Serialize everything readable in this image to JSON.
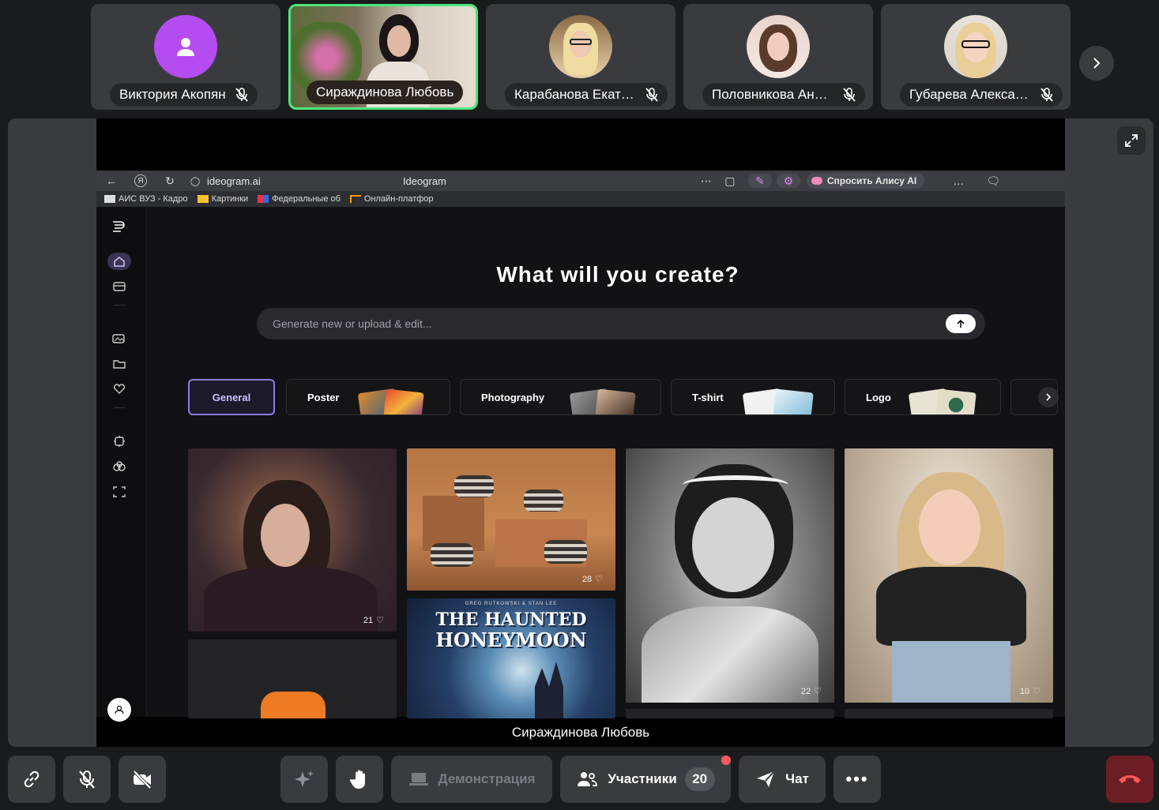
{
  "participants": [
    {
      "name": "Виктория Акопян"
    },
    {
      "name": "Сираждинова Любовь"
    },
    {
      "name": "Карабанова Екате..."
    },
    {
      "name": "Половникова Анас..."
    },
    {
      "name": "Губарева Алексан..."
    }
  ],
  "speaker": {
    "name": "Сираждинова Любовь"
  },
  "browser": {
    "url": "ideogram.ai",
    "tab_title": "Ideogram",
    "alice_label": "Спросить Алису AI",
    "bookmarks": [
      {
        "label": "АИС ВУЗ - Кадро"
      },
      {
        "label": "Картинки"
      },
      {
        "label": "Федеральные об"
      },
      {
        "label": "Онлайн-платфор"
      }
    ]
  },
  "ideogram": {
    "headline": "What will you create?",
    "prompt_placeholder": "Generate new or upload & edit...",
    "categories": [
      {
        "label": "General"
      },
      {
        "label": "Poster"
      },
      {
        "label": "Photography"
      },
      {
        "label": "T-shirt"
      },
      {
        "label": "Logo"
      }
    ],
    "poster_title_1": "THE HAUNTED",
    "poster_title_2": "HONEYMOON",
    "poster_credits": "GREG RUTKOWSKI & STAN LEE",
    "likes": [
      "21",
      "28",
      "22",
      "10"
    ]
  },
  "toolbar": {
    "demo_label": "Демонстрация",
    "participants_label": "Участники",
    "participants_count": "20",
    "chat_label": "Чат"
  },
  "colors": {
    "active_speaker": "#4ee67e",
    "end_call": "#6b1f24",
    "accent_purple": "#8a7cf0"
  }
}
